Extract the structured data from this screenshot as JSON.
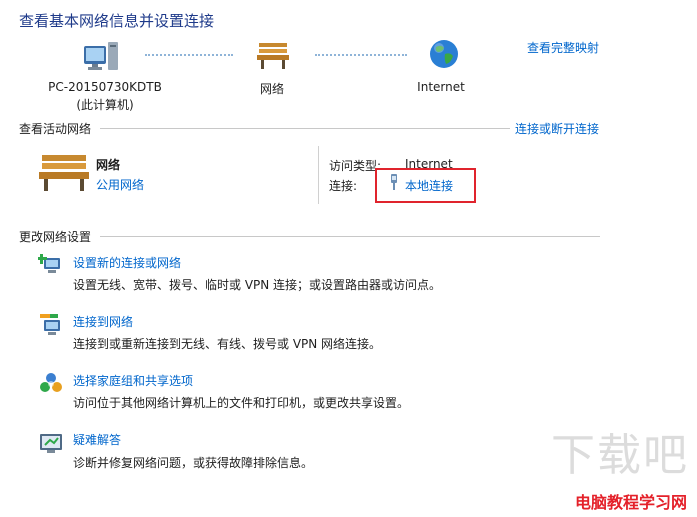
{
  "header": {
    "title": "查看基本网络信息并设置连接",
    "full_map_link": "查看完整映射"
  },
  "map": {
    "computer": {
      "name": "PC-20150730KDTB",
      "sub": "(此计算机)",
      "icon": "computer-icon"
    },
    "network": {
      "name": "网络",
      "icon": "bench-icon"
    },
    "internet": {
      "name": "Internet",
      "icon": "globe-icon"
    }
  },
  "active": {
    "section_title": "查看活动网络",
    "connect_link": "连接或断开连接",
    "network_name": "网络",
    "network_type": "公用网络",
    "access_type_label": "访问类型:",
    "access_type_value": "Internet",
    "connection_label": "连接:",
    "connection_value": "本地连接"
  },
  "change": {
    "section_title": "更改网络设置",
    "items": [
      {
        "title": "设置新的连接或网络",
        "desc": "设置无线、宽带、拨号、临时或 VPN 连接；或设置路由器或访问点。",
        "icon": "new-connection-icon"
      },
      {
        "title": "连接到网络",
        "desc": "连接到或重新连接到无线、有线、拨号或 VPN 网络连接。",
        "icon": "connect-network-icon"
      },
      {
        "title": "选择家庭组和共享选项",
        "desc": "访问位于其他网络计算机上的文件和打印机，或更改共享设置。",
        "icon": "homegroup-icon"
      },
      {
        "title": "疑难解答",
        "desc": "诊断并修复网络问题，或获得故障排除信息。",
        "icon": "troubleshoot-icon"
      }
    ]
  },
  "watermark": {
    "brand": "下载吧",
    "site": "电脑教程学习网"
  },
  "colors": {
    "title": "#1e3a8a",
    "link": "#0066cc",
    "highlight": "#e0242d"
  }
}
